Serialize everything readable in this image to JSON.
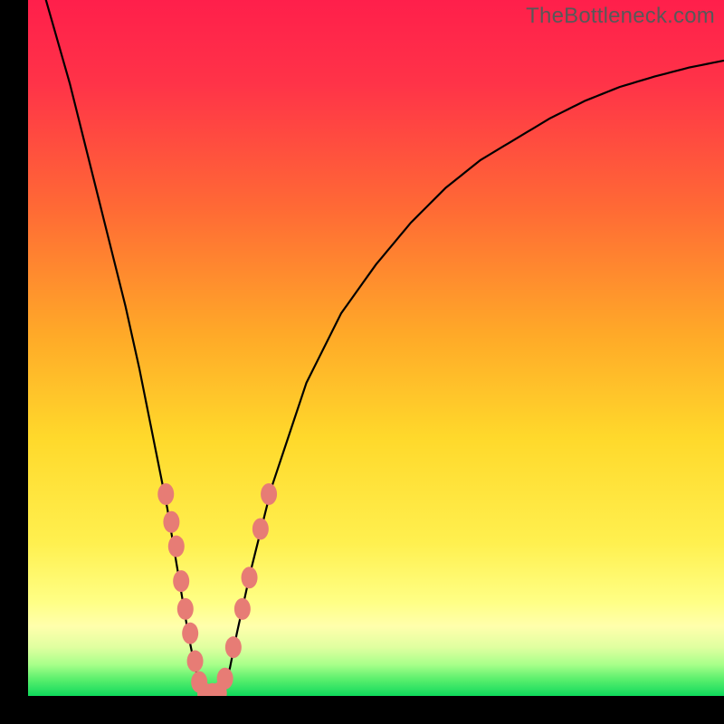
{
  "watermark": "TheBottleneck.com",
  "colors": {
    "frame_bg": "#000000",
    "curve_stroke": "#000000",
    "marker_fill": "#e77c75",
    "gradient_top": "#ff1f4b",
    "gradient_mid1": "#ff8a2a",
    "gradient_mid2": "#ffd92b",
    "gradient_yellow_light": "#ffff9e",
    "gradient_green_light": "#b4ff8c",
    "gradient_green": "#12dd5e"
  },
  "chart_data": {
    "type": "line",
    "title": "",
    "xlabel": "",
    "ylabel": "",
    "xlim": [
      0,
      100
    ],
    "ylim": [
      0,
      100
    ],
    "series": [
      {
        "name": "bottleneck-curve",
        "x": [
          0,
          2,
          4,
          6,
          8,
          10,
          12,
          14,
          16,
          18,
          20,
          22,
          23,
          24,
          25,
          26,
          27,
          28,
          29,
          30,
          32,
          35,
          40,
          45,
          50,
          55,
          60,
          65,
          70,
          75,
          80,
          85,
          90,
          95,
          100
        ],
        "y": [
          108,
          102,
          95,
          88,
          80,
          72,
          64,
          56,
          47,
          37,
          27,
          15,
          9,
          4,
          1,
          0,
          0,
          1,
          4,
          9,
          18,
          30,
          45,
          55,
          62,
          68,
          73,
          77,
          80,
          83,
          85.5,
          87.5,
          89,
          90.3,
          91.3
        ]
      }
    ],
    "markers": [
      {
        "x": 19.8,
        "y": 29
      },
      {
        "x": 20.6,
        "y": 25
      },
      {
        "x": 21.3,
        "y": 21.5
      },
      {
        "x": 22.0,
        "y": 16.5
      },
      {
        "x": 22.6,
        "y": 12.5
      },
      {
        "x": 23.3,
        "y": 9
      },
      {
        "x": 24.0,
        "y": 5
      },
      {
        "x": 24.6,
        "y": 2
      },
      {
        "x": 25.5,
        "y": 0.3
      },
      {
        "x": 26.5,
        "y": 0.3
      },
      {
        "x": 27.4,
        "y": 0.4
      },
      {
        "x": 28.3,
        "y": 2.5
      },
      {
        "x": 29.5,
        "y": 7
      },
      {
        "x": 30.8,
        "y": 12.5
      },
      {
        "x": 31.8,
        "y": 17
      },
      {
        "x": 33.4,
        "y": 24
      },
      {
        "x": 34.6,
        "y": 29
      }
    ],
    "notes": "V-shaped curve over vertical rainbow gradient background; y-axis 0 (bottom, green) to 100 (top, red). Curve minimum at approximately x≈26. Small salmon oval markers clustered along the lower V branches roughly y∈[0,30]."
  }
}
